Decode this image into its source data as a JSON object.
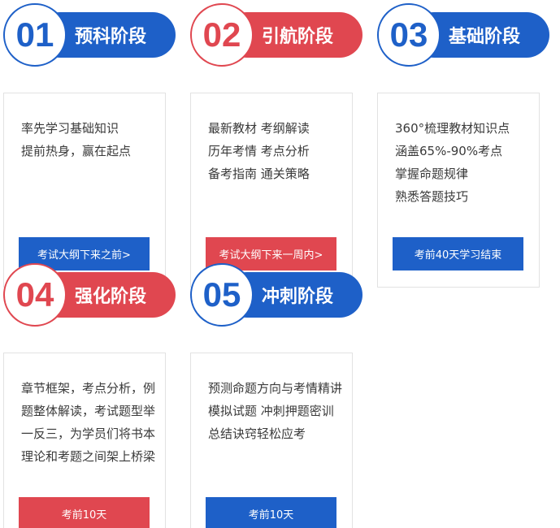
{
  "stages": [
    {
      "number": "01",
      "title": "预科阶段",
      "color": "#1e60c8",
      "lines": [
        "率先学习基础知识",
        "提前热身，赢在起点"
      ],
      "button": "考试大纲下来之前>"
    },
    {
      "number": "02",
      "title": "引航阶段",
      "color": "#e04750",
      "lines": [
        "最新教材 考纲解读",
        "历年考情 考点分析",
        "备考指南 通关策略"
      ],
      "button": "考试大纲下来一周内>"
    },
    {
      "number": "03",
      "title": "基础阶段",
      "color": "#1e60c8",
      "lines": [
        "360°梳理教材知识点",
        "涵盖65%-90%考点",
        "掌握命题规律",
        "熟悉答题技巧"
      ],
      "button": "考前40天学习结束"
    },
    {
      "number": "04",
      "title": "强化阶段",
      "color": "#e04750",
      "text": "章节框架，考点分析，例题整体解读，考试题型举一反三，为学员们将书本理论和考题之间架上桥梁",
      "button": "考前10天"
    },
    {
      "number": "05",
      "title": "冲刺阶段",
      "color": "#1e60c8",
      "text": "预测命题方向与考情精讲模拟试题 冲刺押题密训 总结诀窍轻松应考",
      "button": "考前10天"
    }
  ]
}
